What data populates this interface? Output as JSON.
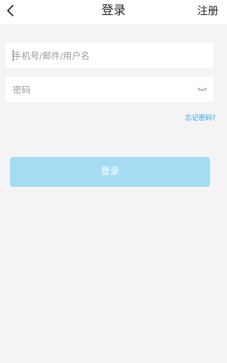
{
  "header": {
    "title": "登录",
    "register_label": "注册",
    "back_icon": "chevron-left-icon"
  },
  "form": {
    "account_placeholder": "手机号/邮件/用户名",
    "account_value": "",
    "password_placeholder": "密码",
    "password_value": "",
    "password_toggle_icon": "eye-closed-icon",
    "forgot_label": "忘记密码?",
    "login_label": "登录"
  },
  "colors": {
    "background": "#f4f4f6",
    "link": "#2a9fd8",
    "login_button_disabled": "#a6dbf4"
  }
}
